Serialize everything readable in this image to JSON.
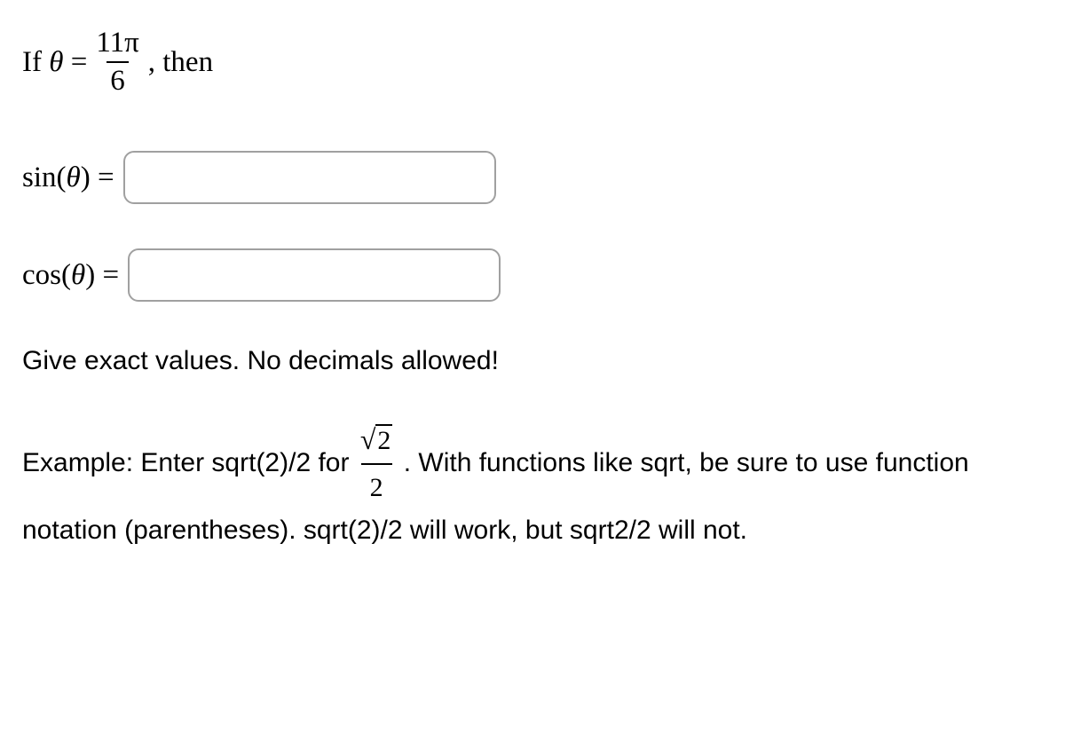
{
  "question": {
    "prefix": "If ",
    "theta": "θ",
    "equals": " = ",
    "frac_num": "11π",
    "frac_den": "6",
    "suffix": ", then"
  },
  "sin": {
    "label_func": "sin",
    "label_arg": "(θ)",
    "label_eq": " = ",
    "value": ""
  },
  "cos": {
    "label_func": "cos",
    "label_arg": "(θ)",
    "label_eq": " = ",
    "value": ""
  },
  "instruction": "Give exact values. No decimals allowed!",
  "example": {
    "prefix": "Example: Enter sqrt(2)/2 for ",
    "sqrt_val": "2",
    "frac_den": "2",
    "middle": ". With functions like sqrt, be sure to use function notation (parentheses). sqrt(2)/2 will work, but sqrt2/2 will not."
  }
}
